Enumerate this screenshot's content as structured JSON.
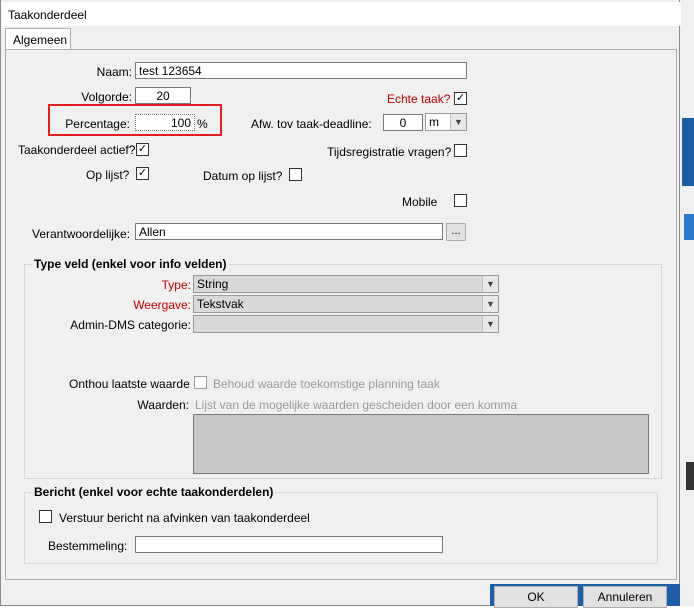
{
  "window": {
    "title": "Taakonderdeel"
  },
  "tabs": [
    {
      "label": "Algemeen"
    }
  ],
  "fields": {
    "naam": {
      "label": "Naam:",
      "value": "test 123654"
    },
    "volgorde": {
      "label": "Volgorde:",
      "value": "20"
    },
    "echte_taak": {
      "label": "Echte taak?",
      "checked": true
    },
    "percentage": {
      "label": "Percentage:",
      "value": "100",
      "unit": "%"
    },
    "afw": {
      "label": "Afw. tov taak-deadline:",
      "value": "0",
      "unit_value": "m"
    },
    "actief": {
      "label": "Taakonderdeel actief?",
      "checked": true
    },
    "tijdsregistratie": {
      "label": "Tijdsregistratie vragen?",
      "checked": false
    },
    "op_lijst": {
      "label": "Op lijst?",
      "checked": true
    },
    "datum_op_lijst": {
      "label": "Datum op lijst?",
      "checked": false
    },
    "mobile": {
      "label": "Mobile",
      "checked": false
    },
    "verantwoordelijke": {
      "label": "Verantwoordelijke:",
      "value": "Allen",
      "button": "..."
    }
  },
  "type_veld": {
    "title": "Type veld (enkel voor info velden)",
    "type": {
      "label": "Type:",
      "value": "String"
    },
    "weergave": {
      "label": "Weergave:",
      "value": "Tekstvak"
    },
    "admin_dms": {
      "label": "Admin-DMS categorie:",
      "value": ""
    },
    "onthou": {
      "label": "Onthou laatste waarde",
      "checkbox_label": "Behoud waarde toekomstige planning taak",
      "checked": false
    },
    "waarden": {
      "label": "Waarden:",
      "hint": "Lijst van de mogelijke waarden gescheiden door een komma"
    }
  },
  "bericht": {
    "title": "Bericht (enkel voor echte taakonderdelen)",
    "verstuur": {
      "label": "Verstuur bericht na afvinken van taakonderdeel",
      "checked": false
    },
    "bestemmeling": {
      "label": "Bestemmeling:",
      "value": ""
    }
  },
  "buttons": {
    "ok": "OK",
    "cancel": "Annuleren"
  },
  "check_mark": "✓",
  "dropdown_arrow": "▼"
}
